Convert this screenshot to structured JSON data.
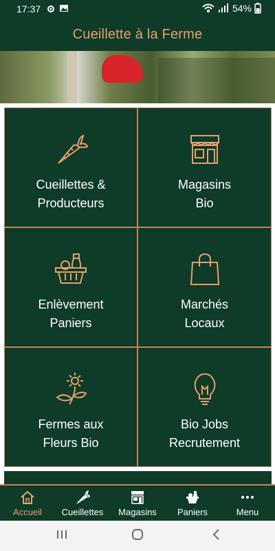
{
  "status": {
    "time": "17:37",
    "battery": "54%"
  },
  "app": {
    "title": "Cueillette à la Ferme"
  },
  "tiles": [
    {
      "line1": "Cueillettes &",
      "line2": "Producteurs",
      "icon": "carrot-icon"
    },
    {
      "line1": "Magasins",
      "line2": "Bio",
      "icon": "store-icon"
    },
    {
      "line1": "Enlèvement",
      "line2": "Paniers",
      "icon": "basket-icon"
    },
    {
      "line1": "Marchés",
      "line2": "Locaux",
      "icon": "shopping-bag-icon"
    },
    {
      "line1": "Fermes aux",
      "line2": "Fleurs Bio",
      "icon": "flower-icon"
    },
    {
      "line1": "Bio Jobs",
      "line2": "Recrutement",
      "icon": "lightbulb-icon"
    }
  ],
  "nav": [
    {
      "label": "Accueil",
      "icon": "home-icon",
      "active": true
    },
    {
      "label": "Cueillettes",
      "icon": "carrot-icon"
    },
    {
      "label": "Magasins",
      "icon": "store-icon"
    },
    {
      "label": "Paniers",
      "icon": "basket-icon"
    },
    {
      "label": "Menu",
      "icon": "more-icon"
    }
  ],
  "colors": {
    "primary": "#0f3b29",
    "accent": "#e8a06b",
    "border": "#c0845a"
  }
}
